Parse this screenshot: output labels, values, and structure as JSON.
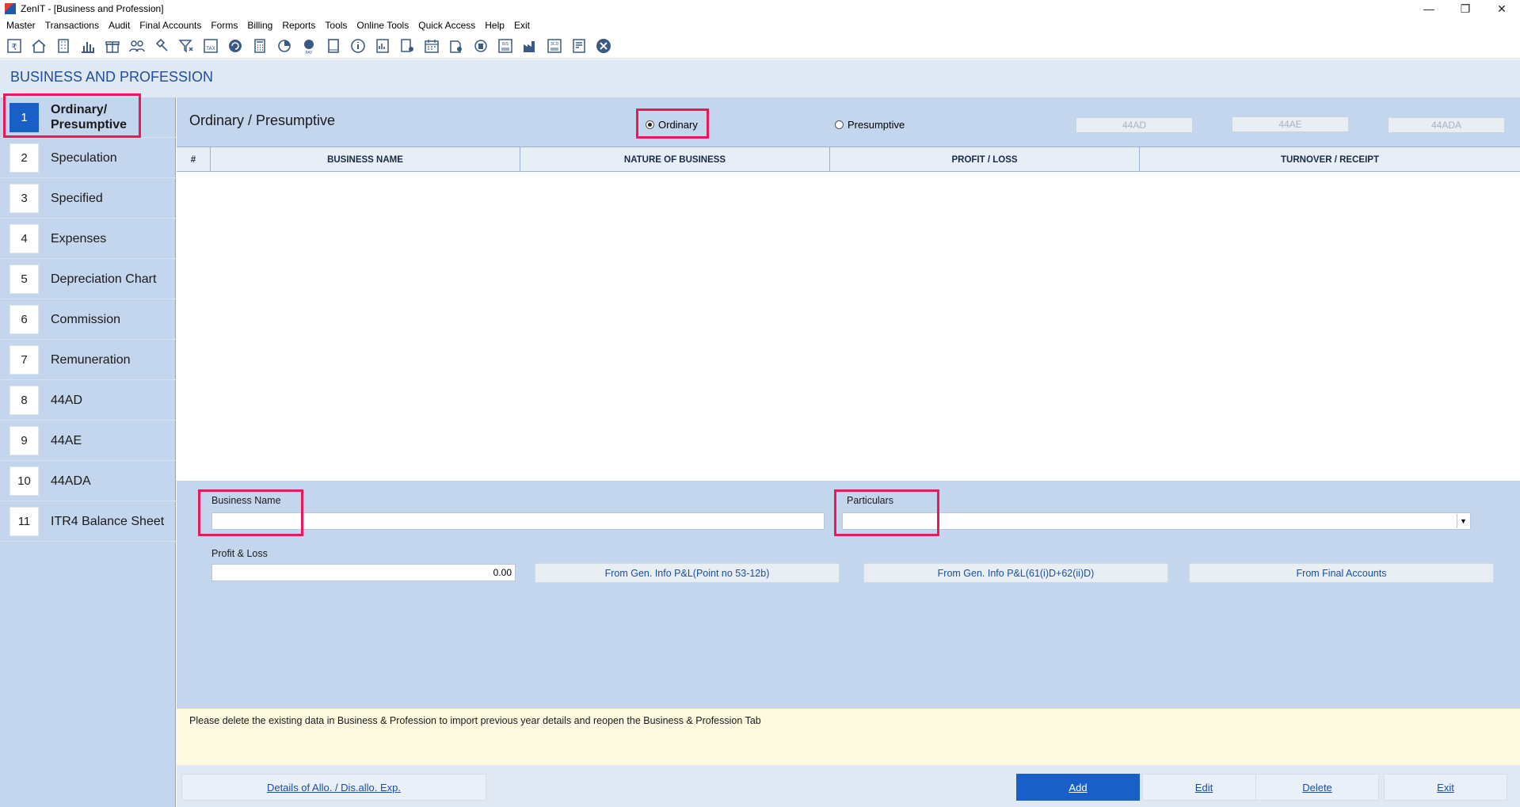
{
  "window": {
    "title": "ZenIT - [Business and Profession]",
    "controls": {
      "minimize": "—",
      "restore": "❐",
      "close": "✕"
    }
  },
  "menu": [
    "Master",
    "Transactions",
    "Audit",
    "Final Accounts",
    "Forms",
    "Billing",
    "Reports",
    "Tools",
    "Online Tools",
    "Quick Access",
    "Help",
    "Exit"
  ],
  "toolbar": {
    "icons": [
      "rupee-icon",
      "home-icon",
      "building-icon",
      "bar-chart-icon",
      "gift-icon",
      "users-icon",
      "gavel-icon",
      "filter-icon",
      "tax-icon",
      "refresh-icon",
      "calculator-icon",
      "pie-icon",
      "pay-icon",
      "book-icon",
      "info-icon",
      "report-icon",
      "document-user-icon",
      "calendar-icon",
      "settings-doc-icon",
      "sync-doc-icon",
      "bis-icon",
      "factory-icon",
      "3cd-icon",
      "ledger-icon",
      "close-circle-icon"
    ]
  },
  "module": {
    "title": "BUSINESS AND PROFESSION"
  },
  "nav": {
    "items": [
      {
        "num": "1",
        "label": "Ordinary/ Presumptive"
      },
      {
        "num": "2",
        "label": "Speculation"
      },
      {
        "num": "3",
        "label": "Specified"
      },
      {
        "num": "4",
        "label": "Expenses"
      },
      {
        "num": "5",
        "label": "Depreciation Chart"
      },
      {
        "num": "6",
        "label": "Commission"
      },
      {
        "num": "7",
        "label": "Remuneration"
      },
      {
        "num": "8",
        "label": "44AD"
      },
      {
        "num": "9",
        "label": "44AE"
      },
      {
        "num": "10",
        "label": "44ADA"
      },
      {
        "num": "11",
        "label": "ITR4 Balance Sheet"
      }
    ],
    "active_index": 0
  },
  "main": {
    "section_title": "Ordinary / Presumptive",
    "radio_ordinary": "Ordinary",
    "radio_presumptive": "Presumptive",
    "selected": "Ordinary",
    "btn_44ad": "44AD",
    "btn_44ae": "44AE",
    "btn_44ada": "44ADA",
    "table": {
      "columns": [
        "#",
        "BUSINESS NAME",
        "NATURE OF BUSINESS",
        "PROFIT / LOSS",
        "TURNOVER / RECEIPT"
      ],
      "rows": []
    }
  },
  "form": {
    "business_name_label": "Business Name",
    "business_name_value": "",
    "particulars_label": "Particulars",
    "particulars_value": "",
    "profit_loss_label": "Profit & Loss",
    "profit_loss_value": "0.00",
    "btn_geninfo_53": "From Gen. Info P&L(Point no 53-12b)",
    "btn_geninfo_61": "From Gen. Info P&L(61(i)D+62(ii)D)",
    "btn_final_accounts": "From Final Accounts"
  },
  "info": {
    "message": "Please delete the existing data in Business &  Profession to import previous year details and reopen the Business & Profession Tab"
  },
  "actions": {
    "details": "Details of Allo. / Dis.allo. Exp.",
    "add": "Add",
    "edit": "Edit",
    "delete": "Delete",
    "exit": "Exit"
  }
}
